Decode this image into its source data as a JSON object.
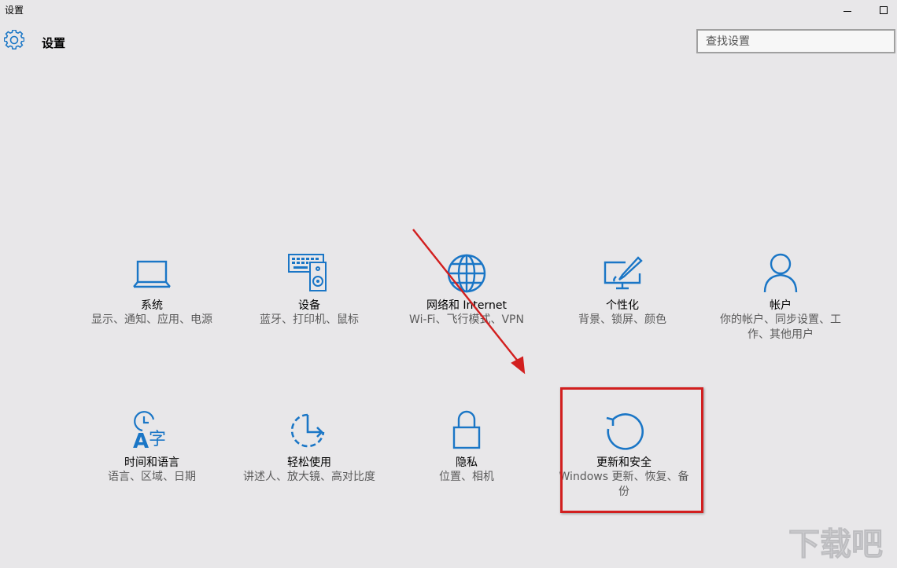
{
  "window": {
    "title": "设置"
  },
  "header": {
    "title": "设置",
    "icon": "gear-icon"
  },
  "search": {
    "placeholder": "查找设置"
  },
  "tiles": [
    {
      "name": "系统",
      "desc": "显示、通知、应用、电源",
      "icon": "laptop-icon"
    },
    {
      "name": "设备",
      "desc": "蓝牙、打印机、鼠标",
      "icon": "keyboard-speaker-icon"
    },
    {
      "name": "网络和 Internet",
      "desc": "Wi-Fi、飞行模式、VPN",
      "icon": "globe-icon"
    },
    {
      "name": "个性化",
      "desc": "背景、锁屏、颜色",
      "icon": "paintbrush-screen-icon"
    },
    {
      "name": "帐户",
      "desc": "你的帐户、同步设置、工作、其他用户",
      "icon": "person-icon"
    },
    {
      "name": "时间和语言",
      "desc": "语言、区域、日期",
      "icon": "clock-language-icon"
    },
    {
      "name": "轻松使用",
      "desc": "讲述人、放大镜、高对比度",
      "icon": "ease-of-access-icon"
    },
    {
      "name": "隐私",
      "desc": "位置、相机",
      "icon": "lock-icon"
    },
    {
      "name": "更新和安全",
      "desc": "Windows 更新、恢复、备份",
      "icon": "refresh-icon"
    }
  ],
  "colors": {
    "accent": "#1a76c6",
    "highlight": "#d21f1f",
    "background": "#e8e7e9"
  },
  "watermark": {
    "text": "下载吧"
  }
}
